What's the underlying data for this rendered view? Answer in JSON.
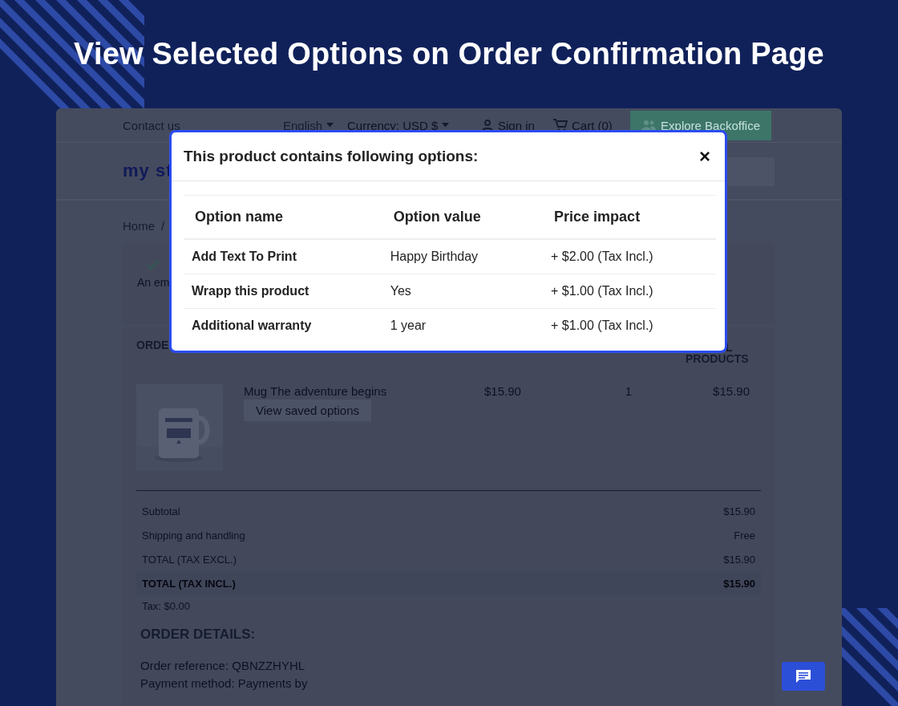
{
  "banner": {
    "title": "View Selected Options on Order Confirmation Page"
  },
  "store": {
    "nav": {
      "contact": "Contact us",
      "language": "English",
      "currency": "Currency: USD $",
      "sign_in": "Sign in",
      "cart": "Cart (0)",
      "backoffice_button": "Explore Backoffice"
    },
    "logo": "my st",
    "breadcrumb": {
      "home": "Home",
      "separator": "/"
    },
    "confirmation": {
      "message": "An em"
    },
    "order_items": {
      "heading": "ORDE",
      "last_column_heading": [
        "L",
        "PRODUCTS"
      ],
      "items": [
        {
          "kind": "picture",
          "name": "Mug The adventure begins",
          "button": "View saved options",
          "price": "$15.90",
          "quantity": "1",
          "total": "$15.90"
        }
      ]
    },
    "totals": [
      {
        "label": "Subtotal",
        "value": "$15.90",
        "emphasis": false
      },
      {
        "label": "Shipping and handling",
        "value": "Free",
        "emphasis": false
      },
      {
        "label": "TOTAL (TAX EXCL.)",
        "value": "$15.90",
        "emphasis": false
      },
      {
        "label": "TOTAL (TAX INCL.)",
        "value": "$15.90",
        "emphasis": true
      }
    ],
    "tax": "Tax: $0.00",
    "order_details": {
      "heading": "ORDER DETAILS:",
      "lines": [
        "Order reference: QBNZZHYHL",
        "Payment method: Payments by"
      ]
    }
  },
  "modal": {
    "title": "This product contains following options:",
    "close": "×",
    "columns": [
      "Option name",
      "Option value",
      "Price impact"
    ],
    "rows": [
      {
        "name": "Add Text To Print",
        "value": "Happy Birthday",
        "price": "+ $2.00 (Tax Incl.)"
      },
      {
        "name": "Wrapp this product",
        "value": "Yes",
        "price": "+ $1.00 (Tax Incl.)"
      },
      {
        "name": "Additional warranty",
        "value": "1 year",
        "price": "+ $1.00 (Tax Incl.)"
      }
    ]
  }
}
